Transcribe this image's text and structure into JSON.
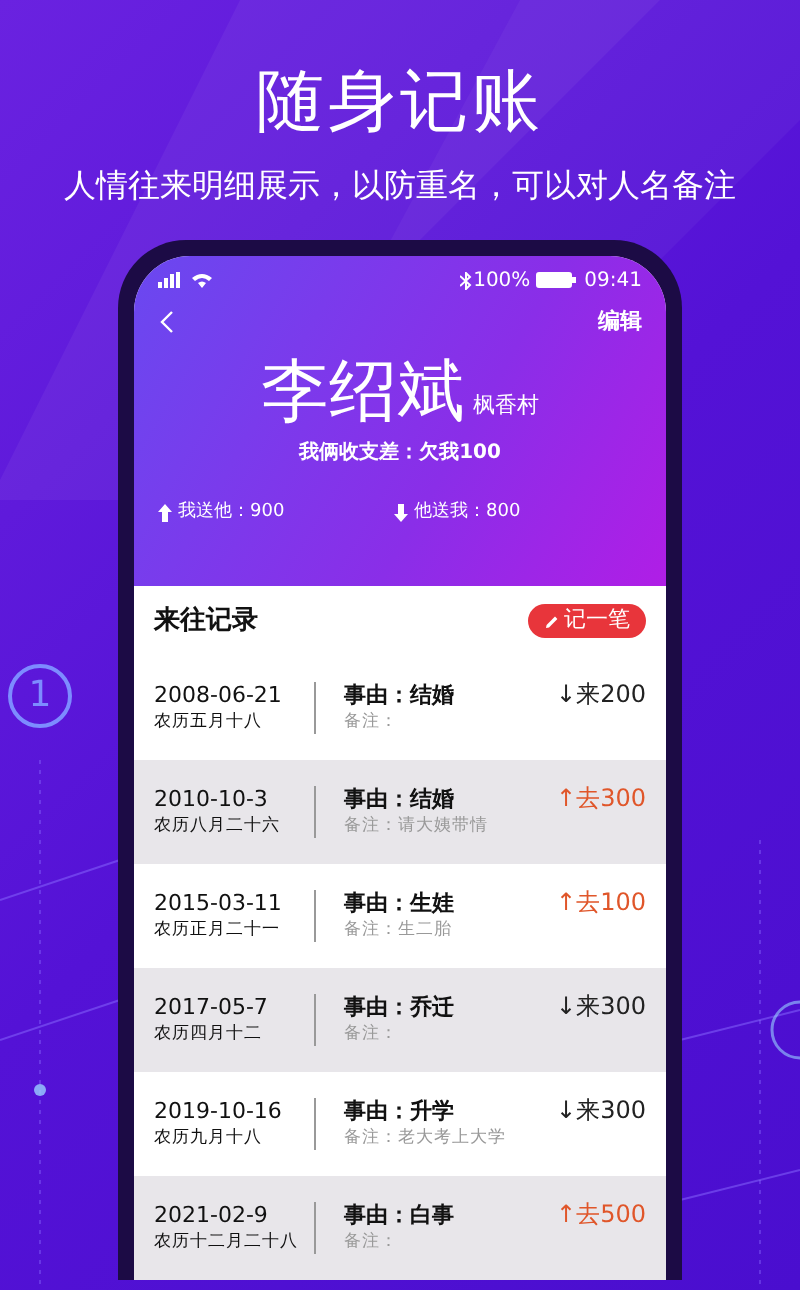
{
  "headline": "随身记账",
  "subtitle": "人情往来明细展示，以防重名，可以对人名备注",
  "side_badge": "1",
  "status_bar": {
    "battery": "100%",
    "time": "09:41"
  },
  "nav": {
    "action": "编辑"
  },
  "person": {
    "name": "李绍斌",
    "village": "枫香村",
    "balance": "我俩收支差：欠我100"
  },
  "totals": [
    {
      "kind": "out",
      "text": "我送他：900"
    },
    {
      "kind": "in",
      "text": "他送我：800"
    }
  ],
  "records": {
    "title": "来往记录",
    "add_button": "记一笔",
    "rows": [
      {
        "date": "2008-06-21",
        "lunar": "农历五月十八",
        "reason": "事由：结婚",
        "note": "备注：",
        "kind": "in",
        "amount": "↓来200"
      },
      {
        "date": "2010-10-3",
        "lunar": "农历八月二十六",
        "reason": "事由：结婚",
        "note": "备注：请大姨带情",
        "kind": "out",
        "amount": "↑去300"
      },
      {
        "date": "2015-03-11",
        "lunar": "农历正月二十一",
        "reason": "事由：生娃",
        "note": "备注：生二胎",
        "kind": "out",
        "amount": "↑去100"
      },
      {
        "date": "2017-05-7",
        "lunar": "农历四月十二",
        "reason": "事由：乔迁",
        "note": "备注：",
        "kind": "in",
        "amount": "↓来300"
      },
      {
        "date": "2019-10-16",
        "lunar": "农历九月十八",
        "reason": "事由：升学",
        "note": "备注：老大考上大学",
        "kind": "in",
        "amount": "↓来300"
      },
      {
        "date": "2021-02-9",
        "lunar": "农历十二月二十八",
        "reason": "事由：白事",
        "note": "备注：",
        "kind": "out",
        "amount": "↑去500"
      }
    ]
  }
}
